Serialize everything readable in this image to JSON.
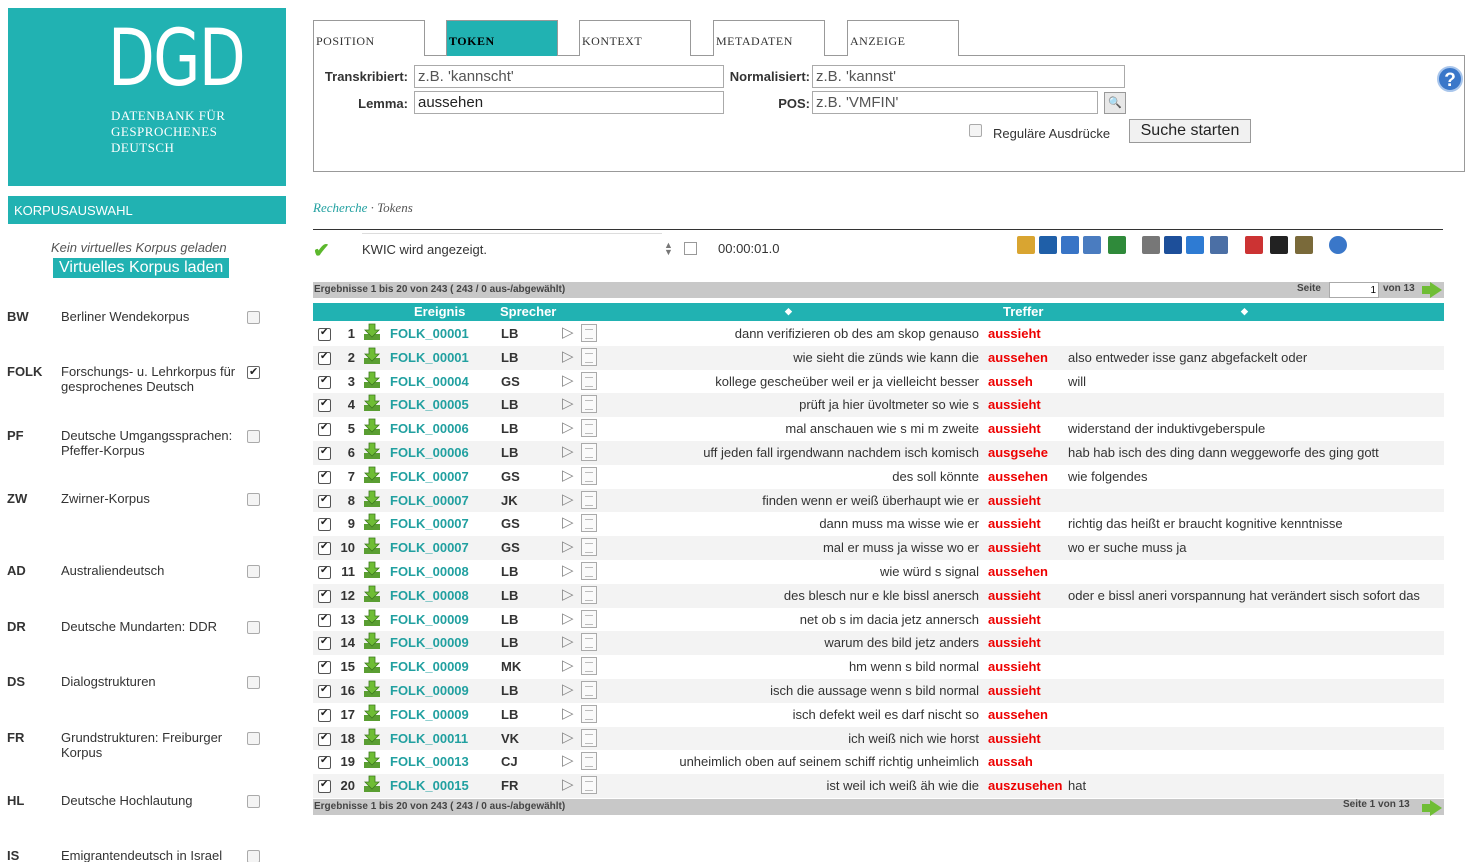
{
  "logo": {
    "big": "DGD",
    "line1": "DATENBANK FÜR",
    "line2": "GESPROCHENES",
    "line3": "DEUTSCH"
  },
  "sidebar": {
    "heading": "KORPUSAUSWAHL",
    "no_corpus": "Kein virtuelles Korpus geladen",
    "load_button": "Virtuelles Korpus laden",
    "corpora": [
      {
        "abbr": "BW",
        "name": "Berliner Wendekorpus",
        "checked": false
      },
      {
        "abbr": "FOLK",
        "name": "Forschungs- u. Lehrkorpus für gesprochenes Deutsch",
        "checked": true
      },
      {
        "abbr": "PF",
        "name": "Deutsche Umgangssprachen: Pfeffer-Korpus",
        "checked": false
      },
      {
        "abbr": "ZW",
        "name": "Zwirner-Korpus",
        "checked": false
      },
      {
        "abbr": "AD",
        "name": "Australiendeutsch",
        "checked": false
      },
      {
        "abbr": "DR",
        "name": "Deutsche Mundarten: DDR",
        "checked": false
      },
      {
        "abbr": "DS",
        "name": "Dialogstrukturen",
        "checked": false
      },
      {
        "abbr": "FR",
        "name": "Grundstrukturen: Freiburger Korpus",
        "checked": false
      },
      {
        "abbr": "HL",
        "name": "Deutsche Hochlautung",
        "checked": false
      },
      {
        "abbr": "IS",
        "name": "Emigrantendeutsch in Israel",
        "checked": false
      }
    ]
  },
  "tabs": [
    "POSITION",
    "TOKEN",
    "KONTEXT",
    "METADATEN",
    "ANZEIGE"
  ],
  "search": {
    "transkribiert_label": "Transkribiert:",
    "transkribiert_placeholder": "z.B. 'kannscht'",
    "normalisiert_label": "Normalisiert:",
    "normalisiert_placeholder": "z.B. 'kannst'",
    "lemma_label": "Lemma:",
    "lemma_value": "aussehen",
    "pos_label": "POS:",
    "pos_placeholder": "z.B. 'VMFIN'",
    "regex_label": "Reguläre Ausdrücke",
    "search_button": "Suche starten",
    "help_icon": "?"
  },
  "breadcrumb": {
    "link": "Recherche",
    "sep": " · ",
    "current": "Tokens"
  },
  "status": {
    "text": "KWIC wird angezeigt.",
    "timer": "00:00:01.0"
  },
  "toolbar_icons": [
    "open-folder-icon",
    "save-icon",
    "fullscreen-icon",
    "export-icon",
    "excel-icon",
    "copy-icon",
    "shuffle-icon",
    "bar-chart-icon",
    "columns-icon",
    "filter-remove-icon",
    "flag-icon",
    "archive-icon",
    "help-icon"
  ],
  "results": {
    "summary_top": "Ergebnisse 1 bis 20 von 243 ( 243 / 0 aus-/abgewählt)",
    "summary_bottom": "Ergebnisse 1 bis 20 von 243 ( 243 / 0 aus-/abgewählt)",
    "page_label": "Seite",
    "page_value": "1",
    "page_total": "von 13",
    "page_bottom": "Seite 1 von 13",
    "col_ereignis": "Ereignis",
    "col_sprecher": "Sprecher",
    "col_treffer": "Treffer",
    "sort_icon": "◆",
    "rows": [
      {
        "num": "1",
        "ev": "FOLK_00001",
        "sp": "LB",
        "left": "dann verifizieren ob des am skop genauso",
        "hit": "aussieht",
        "right": ""
      },
      {
        "num": "2",
        "ev": "FOLK_00001",
        "sp": "LB",
        "left": "wie sieht die zünds wie kann die",
        "hit": "aussehen",
        "right": "also entweder isse ganz abgefackelt oder"
      },
      {
        "num": "3",
        "ev": "FOLK_00004",
        "sp": "GS",
        "left": "kollege gescheüber weil er ja vielleicht besser",
        "hit": "ausseh",
        "right": "will"
      },
      {
        "num": "4",
        "ev": "FOLK_00005",
        "sp": "LB",
        "left": "prüft ja hier üvoltmeter so wie s",
        "hit": "aussieht",
        "right": ""
      },
      {
        "num": "5",
        "ev": "FOLK_00006",
        "sp": "LB",
        "left": "mal anschauen wie s mi m zweite",
        "hit": "aussieht",
        "right": "widerstand der induktivgeberspule"
      },
      {
        "num": "6",
        "ev": "FOLK_00006",
        "sp": "LB",
        "left": "uff jeden fall irgendwann nachdem isch komisch",
        "hit": "ausgsehe",
        "right": "hab hab isch des ding dann weggeworfe des ging gott"
      },
      {
        "num": "7",
        "ev": "FOLK_00007",
        "sp": "GS",
        "left": "des soll könnte",
        "hit": "aussehen",
        "right": "wie folgendes"
      },
      {
        "num": "8",
        "ev": "FOLK_00007",
        "sp": "JK",
        "left": "finden wenn er weiß überhaupt wie er",
        "hit": "aussieht",
        "right": ""
      },
      {
        "num": "9",
        "ev": "FOLK_00007",
        "sp": "GS",
        "left": "dann muss ma wisse wie er",
        "hit": "aussieht",
        "right": "richtig das heißt er braucht kognitive kenntnisse"
      },
      {
        "num": "10",
        "ev": "FOLK_00007",
        "sp": "GS",
        "left": "mal er muss ja wisse wo er",
        "hit": "aussieht",
        "right": "wo er suche muss ja"
      },
      {
        "num": "11",
        "ev": "FOLK_00008",
        "sp": "LB",
        "left": "wie würd s signal",
        "hit": "aussehen",
        "right": ""
      },
      {
        "num": "12",
        "ev": "FOLK_00008",
        "sp": "LB",
        "left": "des blesch nur e kle bissl anersch",
        "hit": "aussieht",
        "right": "oder e bissl aneri vorspannung hat verändert sisch sofort das"
      },
      {
        "num": "13",
        "ev": "FOLK_00009",
        "sp": "LB",
        "left": "net ob s im dacia jetz annersch",
        "hit": "aussieht",
        "right": ""
      },
      {
        "num": "14",
        "ev": "FOLK_00009",
        "sp": "LB",
        "left": "warum des bild jetz anders",
        "hit": "aussieht",
        "right": ""
      },
      {
        "num": "15",
        "ev": "FOLK_00009",
        "sp": "MK",
        "left": "hm wenn s bild normal",
        "hit": "aussieht",
        "right": ""
      },
      {
        "num": "16",
        "ev": "FOLK_00009",
        "sp": "LB",
        "left": "isch die aussage wenn s bild normal",
        "hit": "aussieht",
        "right": ""
      },
      {
        "num": "17",
        "ev": "FOLK_00009",
        "sp": "LB",
        "left": "isch defekt weil es darf nischt so",
        "hit": "aussehen",
        "right": ""
      },
      {
        "num": "18",
        "ev": "FOLK_00011",
        "sp": "VK",
        "left": "ich weiß nich wie horst",
        "hit": "aussieht",
        "right": ""
      },
      {
        "num": "19",
        "ev": "FOLK_00013",
        "sp": "CJ",
        "left": "unheimlich oben auf seinem schiff richtig unheimlich",
        "hit": "aussah",
        "right": ""
      },
      {
        "num": "20",
        "ev": "FOLK_00015",
        "sp": "FR",
        "left": "ist weil ich weiß äh wie die",
        "hit": "auszusehen",
        "right": "hat"
      }
    ]
  }
}
